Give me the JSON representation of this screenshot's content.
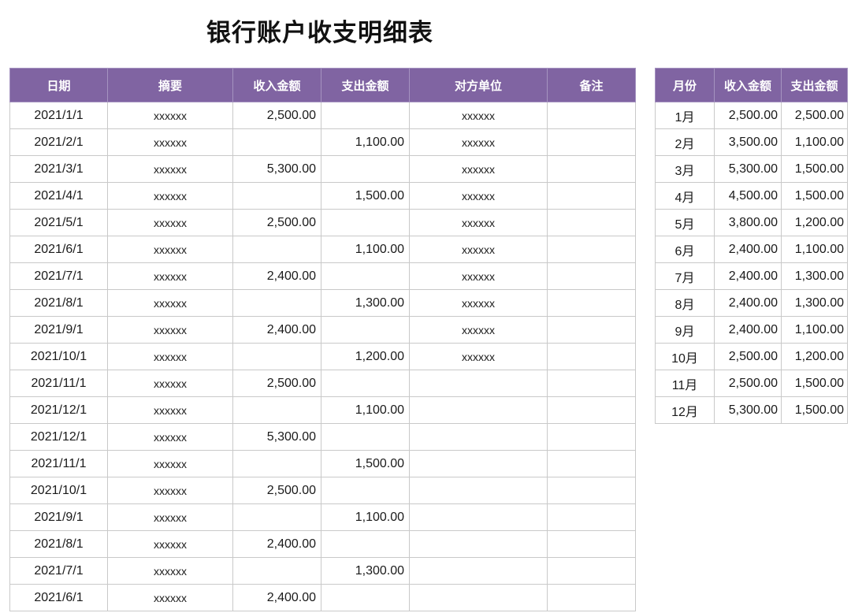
{
  "title": "银行账户收支明细表",
  "main_table": {
    "headers": [
      "日期",
      "摘要",
      "收入金额",
      "支出金额",
      "对方单位",
      "备注"
    ],
    "rows": [
      {
        "date": "2021/1/1",
        "summary": "xxxxxx",
        "income": "2,500.00",
        "expense": "",
        "party": "xxxxxx",
        "note": ""
      },
      {
        "date": "2021/2/1",
        "summary": "xxxxxx",
        "income": "",
        "expense": "1,100.00",
        "party": "xxxxxx",
        "note": ""
      },
      {
        "date": "2021/3/1",
        "summary": "xxxxxx",
        "income": "5,300.00",
        "expense": "",
        "party": "xxxxxx",
        "note": ""
      },
      {
        "date": "2021/4/1",
        "summary": "xxxxxx",
        "income": "",
        "expense": "1,500.00",
        "party": "xxxxxx",
        "note": ""
      },
      {
        "date": "2021/5/1",
        "summary": "xxxxxx",
        "income": "2,500.00",
        "expense": "",
        "party": "xxxxxx",
        "note": ""
      },
      {
        "date": "2021/6/1",
        "summary": "xxxxxx",
        "income": "",
        "expense": "1,100.00",
        "party": "xxxxxx",
        "note": ""
      },
      {
        "date": "2021/7/1",
        "summary": "xxxxxx",
        "income": "2,400.00",
        "expense": "",
        "party": "xxxxxx",
        "note": ""
      },
      {
        "date": "2021/8/1",
        "summary": "xxxxxx",
        "income": "",
        "expense": "1,300.00",
        "party": "xxxxxx",
        "note": ""
      },
      {
        "date": "2021/9/1",
        "summary": "xxxxxx",
        "income": "2,400.00",
        "expense": "",
        "party": "xxxxxx",
        "note": ""
      },
      {
        "date": "2021/10/1",
        "summary": "xxxxxx",
        "income": "",
        "expense": "1,200.00",
        "party": "xxxxxx",
        "note": ""
      },
      {
        "date": "2021/11/1",
        "summary": "xxxxxx",
        "income": "2,500.00",
        "expense": "",
        "party": "",
        "note": ""
      },
      {
        "date": "2021/12/1",
        "summary": "xxxxxx",
        "income": "",
        "expense": "1,100.00",
        "party": "",
        "note": ""
      },
      {
        "date": "2021/12/1",
        "summary": "xxxxxx",
        "income": "5,300.00",
        "expense": "",
        "party": "",
        "note": ""
      },
      {
        "date": "2021/11/1",
        "summary": "xxxxxx",
        "income": "",
        "expense": "1,500.00",
        "party": "",
        "note": ""
      },
      {
        "date": "2021/10/1",
        "summary": "xxxxxx",
        "income": "2,500.00",
        "expense": "",
        "party": "",
        "note": ""
      },
      {
        "date": "2021/9/1",
        "summary": "xxxxxx",
        "income": "",
        "expense": "1,100.00",
        "party": "",
        "note": ""
      },
      {
        "date": "2021/8/1",
        "summary": "xxxxxx",
        "income": "2,400.00",
        "expense": "",
        "party": "",
        "note": ""
      },
      {
        "date": "2021/7/1",
        "summary": "xxxxxx",
        "income": "",
        "expense": "1,300.00",
        "party": "",
        "note": ""
      },
      {
        "date": "2021/6/1",
        "summary": "xxxxxx",
        "income": "2,400.00",
        "expense": "",
        "party": "",
        "note": ""
      }
    ]
  },
  "summary_table": {
    "headers": [
      "月份",
      "收入金额",
      "支出金额"
    ],
    "rows": [
      {
        "month": "1月",
        "income": "2,500.00",
        "expense": "2,500.00"
      },
      {
        "month": "2月",
        "income": "3,500.00",
        "expense": "1,100.00"
      },
      {
        "month": "3月",
        "income": "5,300.00",
        "expense": "1,500.00"
      },
      {
        "month": "4月",
        "income": "4,500.00",
        "expense": "1,500.00"
      },
      {
        "month": "5月",
        "income": "3,800.00",
        "expense": "1,200.00"
      },
      {
        "month": "6月",
        "income": "2,400.00",
        "expense": "1,100.00"
      },
      {
        "month": "7月",
        "income": "2,400.00",
        "expense": "1,300.00"
      },
      {
        "month": "8月",
        "income": "2,400.00",
        "expense": "1,300.00"
      },
      {
        "month": "9月",
        "income": "2,400.00",
        "expense": "1,100.00"
      },
      {
        "month": "10月",
        "income": "2,500.00",
        "expense": "1,200.00"
      },
      {
        "month": "11月",
        "income": "2,500.00",
        "expense": "1,500.00"
      },
      {
        "month": "12月",
        "income": "5,300.00",
        "expense": "1,500.00"
      }
    ]
  },
  "colors": {
    "header_bg": "#8064a2",
    "header_text": "#ffffff",
    "grid": "#c9c9c9"
  }
}
